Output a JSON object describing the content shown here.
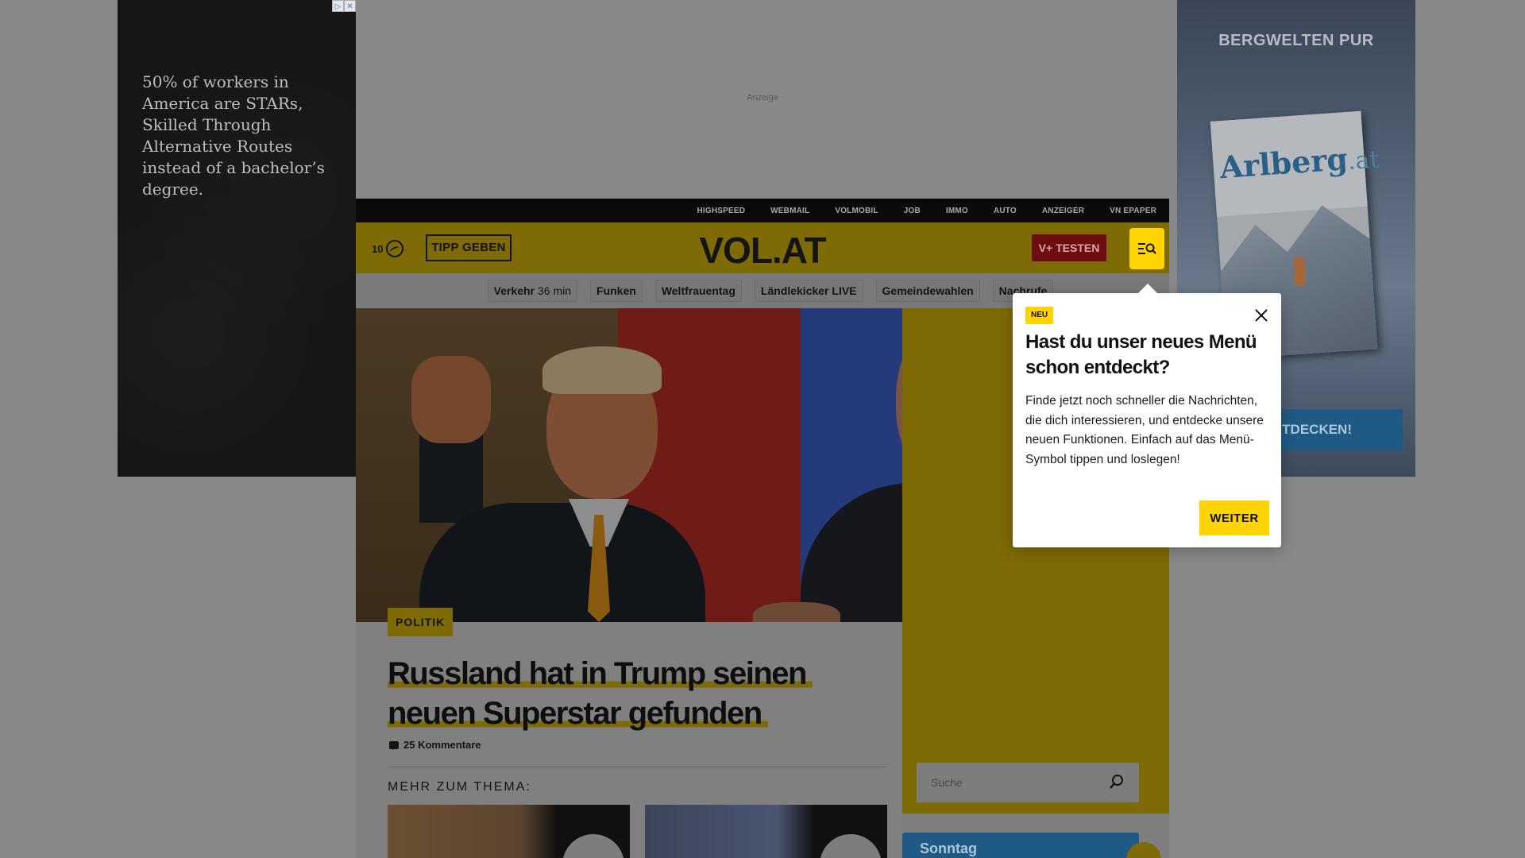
{
  "ads": {
    "left_text": "50% of workers in America are STARs, Skilled Through Alternative Routes instead of a bachelor’s degree.",
    "top_label": "Anzeige",
    "right_title": "BERGWELTEN PUR",
    "right_mag_logo": "Arlberg",
    "right_mag_logo_suffix": ".at",
    "right_cta": "ENTDECKEN!"
  },
  "topbar": {
    "links": [
      "HIGHSPEED",
      "WEBMAIL",
      "VOLMOBIL",
      "JOB",
      "IMMO",
      "AUTO",
      "ANZEIGER",
      "VN EPAPER"
    ]
  },
  "header": {
    "count": "10",
    "tipp_label": "TIPP GEBEN",
    "logo": "VOL.AT",
    "vplus_label": "V+ TESTEN"
  },
  "chips": [
    {
      "label": "Verkehr",
      "sub": "36 min"
    },
    {
      "label": "Funken",
      "sub": ""
    },
    {
      "label": "Weltfrauentag",
      "sub": ""
    },
    {
      "label": "Ländlekicker LIVE",
      "sub": ""
    },
    {
      "label": "Gemeindewahlen",
      "sub": ""
    },
    {
      "label": "Nachrufe",
      "sub": ""
    }
  ],
  "article": {
    "category": "POLITIK",
    "headline_line1": "Russland hat in Trump seinen",
    "headline_line2": "neuen Superstar gefunden",
    "comments": "25 Kommentare",
    "more_label": "MEHR ZUM THEMA:"
  },
  "sidebar": {
    "search_placeholder": "Suche",
    "box_title": "Sonntag"
  },
  "popup": {
    "badge": "NEU",
    "title": "Hast du unser neues Menü schon entdeckt?",
    "body": "Finde jetzt noch schneller die Nachrichten, die dich interessieren, und entdecke unsere neuen Funktionen. Einfach auf das Menü-Symbol tippen und loslegen!",
    "button": "WEITER"
  },
  "colors": {
    "brand_yellow": "#ffd400",
    "vplus_red": "#c8161d",
    "accent_blue": "#2a7fc0"
  }
}
